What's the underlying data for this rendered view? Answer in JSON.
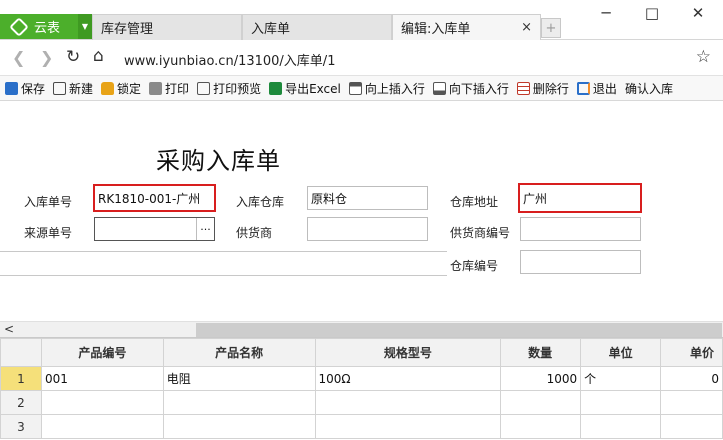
{
  "app": {
    "name": "云表"
  },
  "tabs": [
    {
      "label": "库存管理"
    },
    {
      "label": "入库单"
    },
    {
      "label": "编辑:入库单",
      "close": "×"
    }
  ],
  "window": {
    "minimize": "─",
    "maximize": "□",
    "close": "✕"
  },
  "address": {
    "url": "www.iyunbiao.cn/13100/入库单/1"
  },
  "toolbar": {
    "items": [
      {
        "label": "保存",
        "icon": "save-icon",
        "color": "#2a6fc9"
      },
      {
        "label": "新建",
        "icon": "new-icon",
        "color": "#4a4a4a"
      },
      {
        "label": "锁定",
        "icon": "lock-icon",
        "color": "#e8a317"
      },
      {
        "label": "打印",
        "icon": "print-icon",
        "color": "#555555"
      },
      {
        "label": "打印预览",
        "icon": "print-preview-icon",
        "color": "#555555"
      },
      {
        "label": "导出Excel",
        "icon": "excel-icon",
        "color": "#1e8a3c"
      },
      {
        "label": "向上插入行",
        "icon": "insert-row-above-icon",
        "color": "#555555"
      },
      {
        "label": "向下插入行",
        "icon": "insert-row-below-icon",
        "color": "#555555"
      },
      {
        "label": "删除行",
        "icon": "delete-row-icon",
        "color": "#c0392b"
      },
      {
        "label": "退出",
        "icon": "exit-icon",
        "color": "#2a6fc9"
      },
      {
        "label": "确认入库",
        "icon": "",
        "color": ""
      }
    ]
  },
  "form": {
    "title": "采购入库单",
    "receipt_no_label": "入库单号",
    "receipt_no": "RK1810-001-广州",
    "warehouse_label": "入库仓库",
    "warehouse": "原料仓",
    "warehouse_address_label": "仓库地址",
    "warehouse_address": "广州",
    "source_no_label": "来源单号",
    "source_no": "",
    "picker_button": "···",
    "supplier_label": "供货商",
    "supplier": "",
    "supplier_no_label": "供货商编号",
    "supplier_no": "",
    "warehouse_no_label": "仓库编号",
    "warehouse_no": ""
  },
  "grid": {
    "columns": [
      "产品编号",
      "产品名称",
      "规格型号",
      "数量",
      "单位",
      "单价"
    ],
    "rows": [
      {
        "n": "1",
        "code": "001",
        "name": "电阻",
        "spec": "100Ω",
        "qty": "1000",
        "unit": "个",
        "price": "0"
      },
      {
        "n": "2",
        "code": "",
        "name": "",
        "spec": "",
        "qty": "",
        "unit": "",
        "price": ""
      },
      {
        "n": "3",
        "code": "",
        "name": "",
        "spec": "",
        "qty": "",
        "unit": "",
        "price": ""
      }
    ]
  },
  "colors": {
    "brand": "#4caf2b",
    "highlight": "#d81e1e",
    "selected_row": "#f5e07a"
  }
}
